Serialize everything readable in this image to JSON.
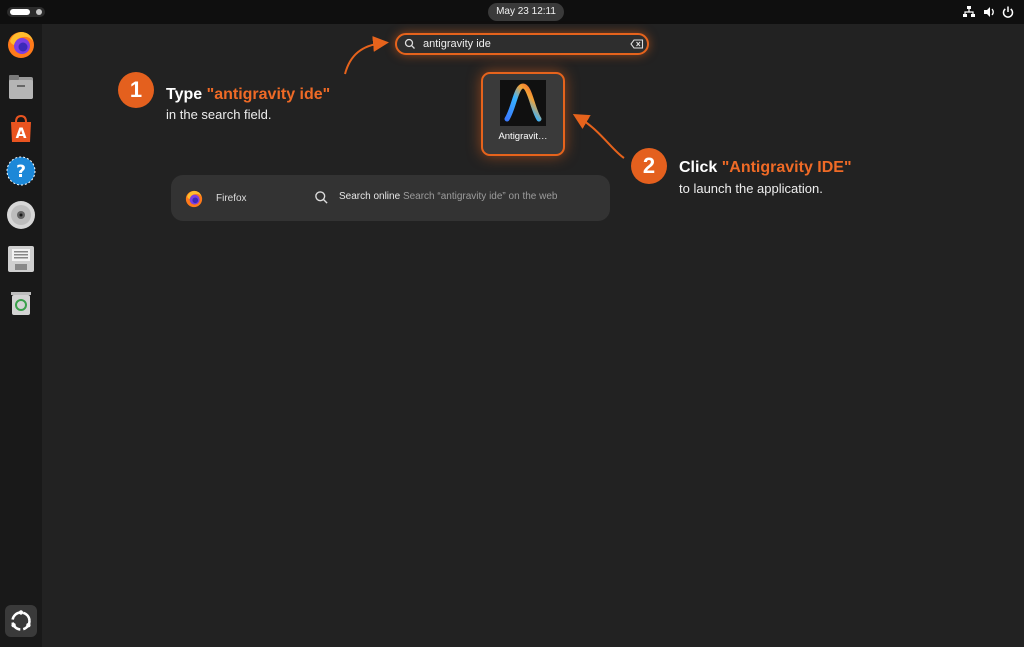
{
  "topbar": {
    "datetime": "May 23  12:11",
    "tray": [
      "network-icon",
      "volume-icon",
      "power-icon"
    ]
  },
  "dock": {
    "apps": [
      "firefox",
      "files",
      "app-center",
      "help",
      "disc",
      "floppy-save",
      "trash",
      "show-apps"
    ]
  },
  "search": {
    "value": "antigravity ide",
    "icon": "search-icon",
    "clear_icon": "backspace-icon"
  },
  "app_result": {
    "label": "Antigravit…",
    "icon": "antigravity-icon"
  },
  "results_row": {
    "firefox_label": "Firefox",
    "search_online": "Search online",
    "search_web": "Search “antigravity ide” on the web"
  },
  "annotations": {
    "step1": {
      "number": "1",
      "prefix": "Type ",
      "highlight": "\"antigravity ide\"",
      "sub": "in the search field."
    },
    "step2": {
      "number": "2",
      "prefix": "Click ",
      "highlight": "\"Antigravity IDE\"",
      "sub": "to launch the application."
    }
  },
  "colors": {
    "accent": "#e6631c",
    "background": "#222222",
    "dock": "#191919",
    "topbar": "#0f0f0f"
  }
}
